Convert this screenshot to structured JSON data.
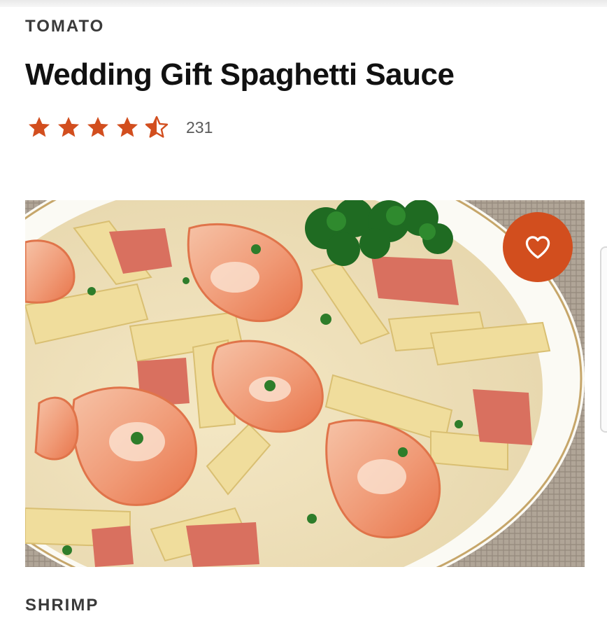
{
  "recipe": {
    "category": "TOMATO",
    "title": "Wedding Gift Spaghetti Sauce",
    "rating": {
      "stars": 4.5,
      "max_stars": 5,
      "count": "231",
      "star_color": "#D24E1E"
    },
    "photo": {
      "icon": "pasta-photo"
    },
    "favorite": {
      "icon": "heart-icon",
      "color": "#D24E1E"
    }
  },
  "next": {
    "category": "SHRIMP"
  }
}
